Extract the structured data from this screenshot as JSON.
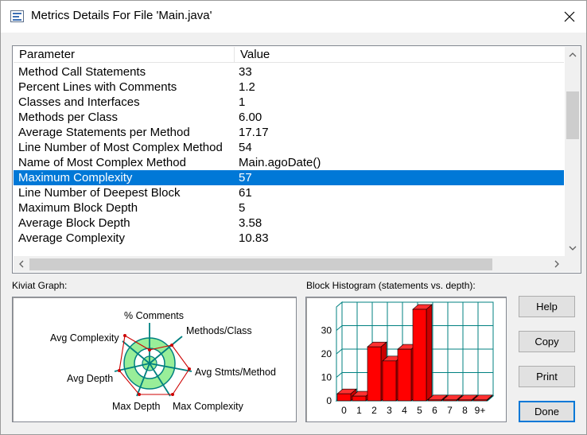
{
  "window": {
    "title": "Metrics Details For File 'Main.java'",
    "icons": {
      "app": "metrics-window-icon",
      "close": "close-icon"
    }
  },
  "metrics_table": {
    "columns": [
      "Parameter",
      "Value"
    ],
    "rows": [
      {
        "parameter": "Method Call Statements",
        "value": "33"
      },
      {
        "parameter": "Percent Lines with Comments",
        "value": "1.2"
      },
      {
        "parameter": "Classes and Interfaces",
        "value": "1"
      },
      {
        "parameter": "Methods per Class",
        "value": "6.00"
      },
      {
        "parameter": "Average Statements per Method",
        "value": "17.17"
      },
      {
        "parameter": "Line Number of Most Complex Method",
        "value": "54"
      },
      {
        "parameter": "Name of Most Complex Method",
        "value": "Main.agoDate()"
      },
      {
        "parameter": "Maximum Complexity",
        "value": "57",
        "selected": true
      },
      {
        "parameter": "Line Number of Deepest Block",
        "value": "61"
      },
      {
        "parameter": "Maximum Block Depth",
        "value": "5"
      },
      {
        "parameter": "Average Block Depth",
        "value": "3.58"
      },
      {
        "parameter": "Average Complexity",
        "value": "10.83"
      }
    ],
    "selection_color": "#0078d7"
  },
  "kiviat": {
    "label": "Kiviat Graph:",
    "axes": [
      "% Comments",
      "Methods/Class",
      "Avg Stmts/Method",
      "Max Complexity",
      "Max Depth",
      "Avg Depth",
      "Avg Complexity"
    ],
    "ring_color": "#99ee99",
    "axis_color": "#008080",
    "polygon_color": "#cc0000"
  },
  "histogram": {
    "label": "Block Histogram (statements vs. depth):",
    "bar_color": "#ff0000",
    "grid_color": "#008080"
  },
  "buttons": {
    "help": "Help",
    "copy": "Copy",
    "print": "Print",
    "done": "Done"
  },
  "chart_data": {
    "type": "bar",
    "title": "Block Histogram (statements vs. depth)",
    "categories": [
      "0",
      "1",
      "2",
      "3",
      "4",
      "5",
      "6",
      "7",
      "8",
      "9+"
    ],
    "values": [
      3,
      2,
      23,
      17,
      22,
      39,
      0,
      0,
      0,
      0
    ],
    "yticks": [
      "0",
      "10",
      "20",
      "30"
    ],
    "ylim": [
      0,
      40
    ],
    "grid": true
  }
}
